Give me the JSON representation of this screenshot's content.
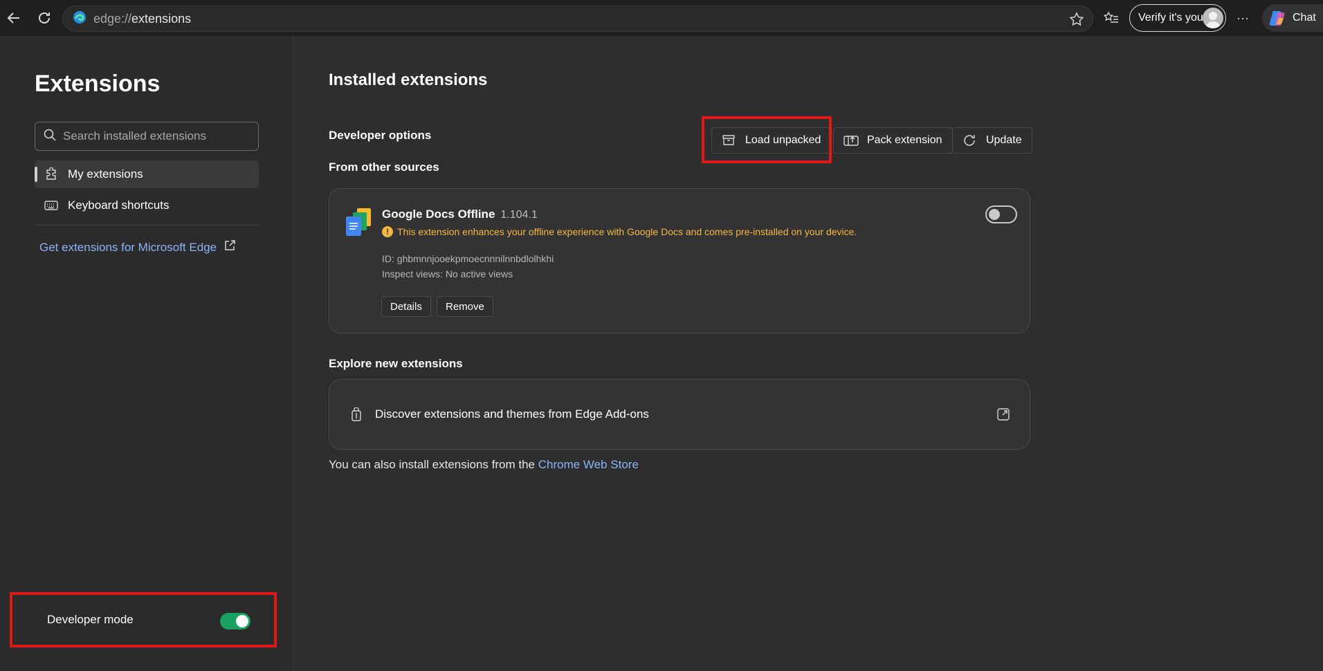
{
  "browser": {
    "url_protocol": "edge://",
    "url_path": "extensions",
    "verify_label": "Verify it's you",
    "chat_label": "Chat",
    "more_label": "···"
  },
  "sidebar": {
    "title": "Extensions",
    "search_placeholder": "Search installed extensions",
    "items": [
      {
        "label": "My extensions",
        "icon": "puzzle-icon",
        "active": true
      },
      {
        "label": "Keyboard shortcuts",
        "icon": "keyboard-icon",
        "active": false
      }
    ],
    "get_extensions_label": "Get extensions for Microsoft Edge",
    "developer_mode_label": "Developer mode",
    "developer_mode_on": true
  },
  "main": {
    "title": "Installed extensions",
    "developer_options_label": "Developer options",
    "buttons": {
      "load_unpacked": "Load unpacked",
      "pack_extension": "Pack extension",
      "update": "Update"
    },
    "from_other_sources_label": "From other sources",
    "extension": {
      "name": "Google Docs Offline",
      "version": "1.104.1",
      "warning": "This extension enhances your offline experience with Google Docs and comes pre-installed on your device.",
      "id_text": "ID: ghbmnnjooekpmoecnnnilnnbdlolhkhi",
      "inspect_text": "Inspect views: No active views",
      "details_label": "Details",
      "remove_label": "Remove",
      "enabled": false
    },
    "explore_label": "Explore new extensions",
    "discover_label": "Discover extensions and themes from Edge Add-ons",
    "also_text": "You can also install extensions from the ",
    "chrome_store_link": "Chrome Web Store"
  }
}
